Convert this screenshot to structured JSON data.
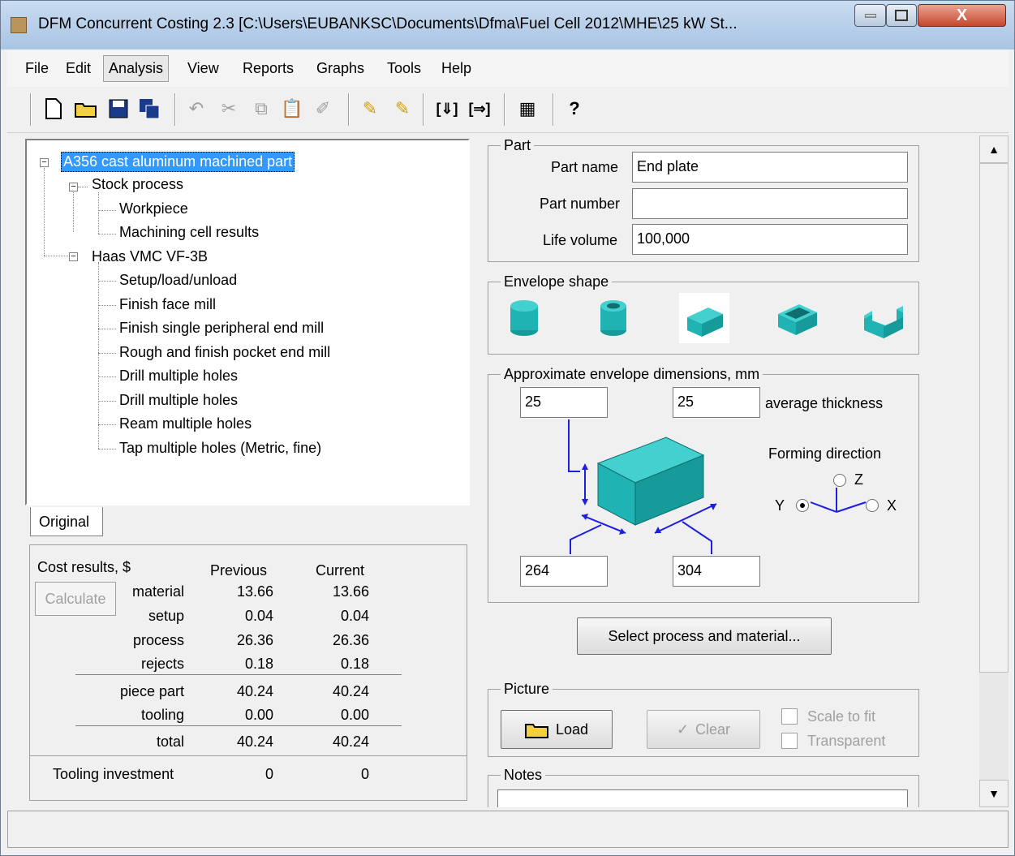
{
  "window": {
    "title": "DFM Concurrent Costing 2.3 [C:\\Users\\EUBANKSC\\Documents\\Dfma\\Fuel Cell 2012\\MHE\\25 kW St...",
    "close_label": "X"
  },
  "menu": {
    "file": "File",
    "edit": "Edit",
    "analysis": "Analysis",
    "view": "View",
    "reports": "Reports",
    "graphs": "Graphs",
    "tools": "Tools",
    "help": "Help"
  },
  "tree": {
    "root": "A356 cast aluminum machined part",
    "stock_process": "Stock process",
    "workpiece": "Workpiece",
    "machining_cell_results": "Machining cell results",
    "machine": "Haas VMC VF-3B",
    "operations": [
      "Setup/load/unload",
      "Finish face mill",
      "Finish single peripheral end mill",
      "Rough and finish pocket end mill",
      "Drill multiple holes",
      "Drill multiple holes",
      "Ream multiple holes",
      "Tap multiple holes (Metric, fine)"
    ]
  },
  "tab": {
    "original": "Original"
  },
  "cost": {
    "title": "Cost results, $",
    "col_previous": "Previous",
    "col_current": "Current",
    "calculate": "Calculate",
    "rows": [
      {
        "label": "material",
        "previous": "13.66",
        "current": "13.66"
      },
      {
        "label": "setup",
        "previous": "0.04",
        "current": "0.04"
      },
      {
        "label": "process",
        "previous": "26.36",
        "current": "26.36"
      },
      {
        "label": "rejects",
        "previous": "0.18",
        "current": "0.18"
      },
      {
        "label": "piece part",
        "previous": "40.24",
        "current": "40.24"
      },
      {
        "label": "tooling",
        "previous": "0.00",
        "current": "0.00"
      },
      {
        "label": "total",
        "previous": "40.24",
        "current": "40.24"
      }
    ],
    "tooling_investment": {
      "label": "Tooling investment",
      "previous": "0",
      "current": "0"
    }
  },
  "part": {
    "group": "Part",
    "name_label": "Part name",
    "name_value": "End plate",
    "number_label": "Part number",
    "number_value": "",
    "volume_label": "Life volume",
    "volume_value": "100,000"
  },
  "envelope": {
    "group": "Envelope shape",
    "shapes": [
      "solid-cylinder",
      "hollow-cylinder",
      "flat-box",
      "hollow-box",
      "channel"
    ],
    "selected": "flat-box",
    "color": "#1fb3b3"
  },
  "dims": {
    "group": "Approximate envelope dimensions, mm",
    "top_left": "25",
    "top_right": "25",
    "thickness_label": "average thickness",
    "bottom_left": "264",
    "bottom_right": "304",
    "forming_label": "Forming direction",
    "z": "Z",
    "y": "Y",
    "x": "X",
    "selected_direction": "Y"
  },
  "select_btn": "Select process and material...",
  "picture": {
    "group": "Picture",
    "load": "Load",
    "clear": "Clear",
    "scale": "Scale to fit",
    "transparent": "Transparent"
  },
  "notes": {
    "group": "Notes",
    "value": ""
  }
}
